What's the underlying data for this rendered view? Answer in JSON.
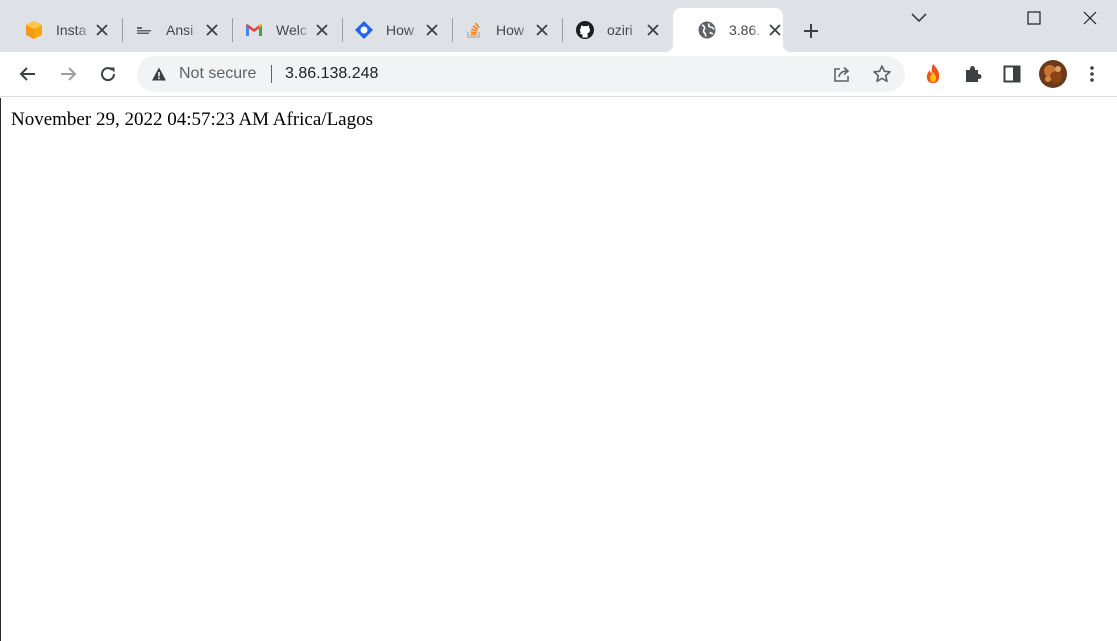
{
  "browser": {
    "tabs": [
      {
        "title": "Insta",
        "icon": "aws-box-icon"
      },
      {
        "title": "Ansi",
        "icon": "ansible-doc-icon"
      },
      {
        "title": "Welc",
        "icon": "gmail-icon"
      },
      {
        "title": "How",
        "icon": "diamond-blue-icon"
      },
      {
        "title": "How",
        "icon": "stackoverflow-icon"
      },
      {
        "title": "oziri",
        "icon": "github-icon"
      },
      {
        "title": "3.86.",
        "icon": "globe-icon",
        "active": true
      }
    ],
    "omnibox": {
      "security_label": "Not secure",
      "url": "3.86.138.248"
    }
  },
  "page": {
    "datetime_text": "November 29, 2022 04:57:23 AM Africa/Lagos"
  },
  "colors": {
    "tabstrip_bg": "#dee1e6",
    "omnibox_bg": "#f1f3f4",
    "icon_gray": "#5f6368"
  }
}
